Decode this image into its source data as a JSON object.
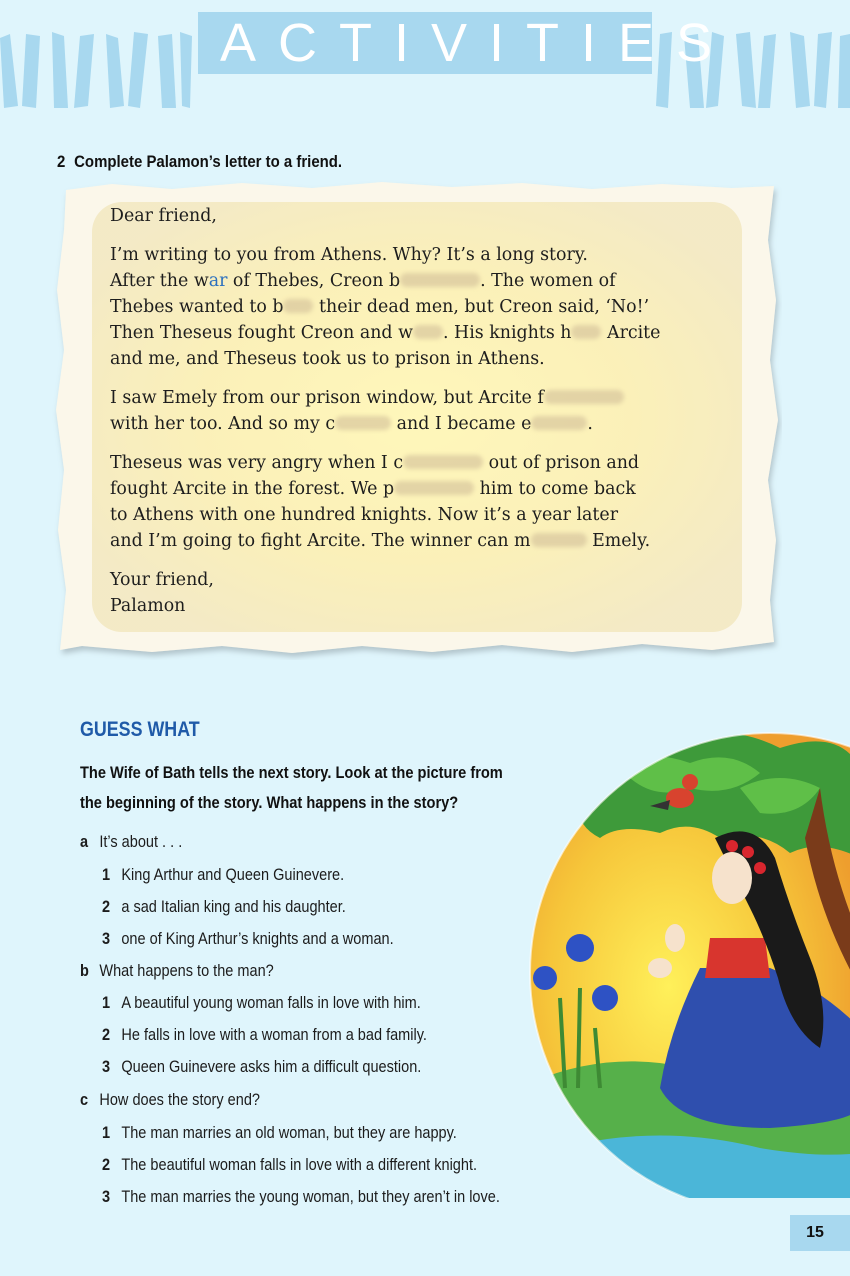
{
  "header": {
    "title": "ACTIVITIES"
  },
  "exercise": {
    "number": "2",
    "instruction": "Complete Palamon’s letter to a friend."
  },
  "letter": {
    "greeting": "Dear friend,",
    "p1": {
      "s1": "I’m writing to you from Athens. Why?  It’s a long story.",
      "s2a": "After the w",
      "s2_answer": "ar",
      "s2b": " of Thebes, Creon b",
      "s2c": ". The women of",
      "s3a": "Thebes wanted to b",
      "s3b": " their dead men, but Creon said, ‘No!’",
      "s4a": "Then Theseus fought Creon and w",
      "s4b": ". His knights h",
      "s4c": " Arcite",
      "s5": "and me, and Theseus took us to prison in Athens."
    },
    "p2": {
      "a": "I saw Emely from our prison window, but Arcite f",
      "b": "with her too. And so my c",
      "c": " and I became e",
      "d": "."
    },
    "p3": {
      "a": "Theseus was very angry when I c",
      "b": " out of prison and",
      "c": "fought Arcite in the forest. We p",
      "d": " him to come back",
      "e": "to Athens with one hundred knights. Now it’s a year later",
      "f": "and I’m going to fight Arcite. The winner can m",
      "g": " Emely."
    },
    "closing": "Your friend,",
    "signature": "Palamon"
  },
  "guess": {
    "title": "GUESS WHAT",
    "intro_line1": "The Wife of Bath tells the next story. Look at the picture from",
    "intro_line2": "the beginning of the story. What happens in the story?",
    "questions": [
      {
        "letter": "a",
        "text": "It’s about . . .",
        "options": [
          {
            "n": "1",
            "text": "King Arthur and Queen Guinevere."
          },
          {
            "n": "2",
            "text": "a sad Italian king and his daughter."
          },
          {
            "n": "3",
            "text": "one of King Arthur’s knights and a woman."
          }
        ]
      },
      {
        "letter": "b",
        "text": "What happens to the man?",
        "options": [
          {
            "n": "1",
            "text": "A beautiful young woman falls in love with him."
          },
          {
            "n": "2",
            "text": "He falls in love with a woman from a bad family."
          },
          {
            "n": "3",
            "text": "Queen Guinevere asks him a difficult question."
          }
        ]
      },
      {
        "letter": "c",
        "text": "How does the story end?",
        "options": [
          {
            "n": "1",
            "text": "The man marries an old woman, but they are happy."
          },
          {
            "n": "2",
            "text": "The beautiful woman falls in love with a different knight."
          },
          {
            "n": "3",
            "text": "The man marries the young woman, but they aren’t in love."
          }
        ]
      }
    ]
  },
  "page_number": "15",
  "colors": {
    "background": "#dff5fc",
    "banner": "#a8d8ef",
    "heading_blue": "#1f5aa8",
    "answer_blue": "#2a6fbf"
  }
}
